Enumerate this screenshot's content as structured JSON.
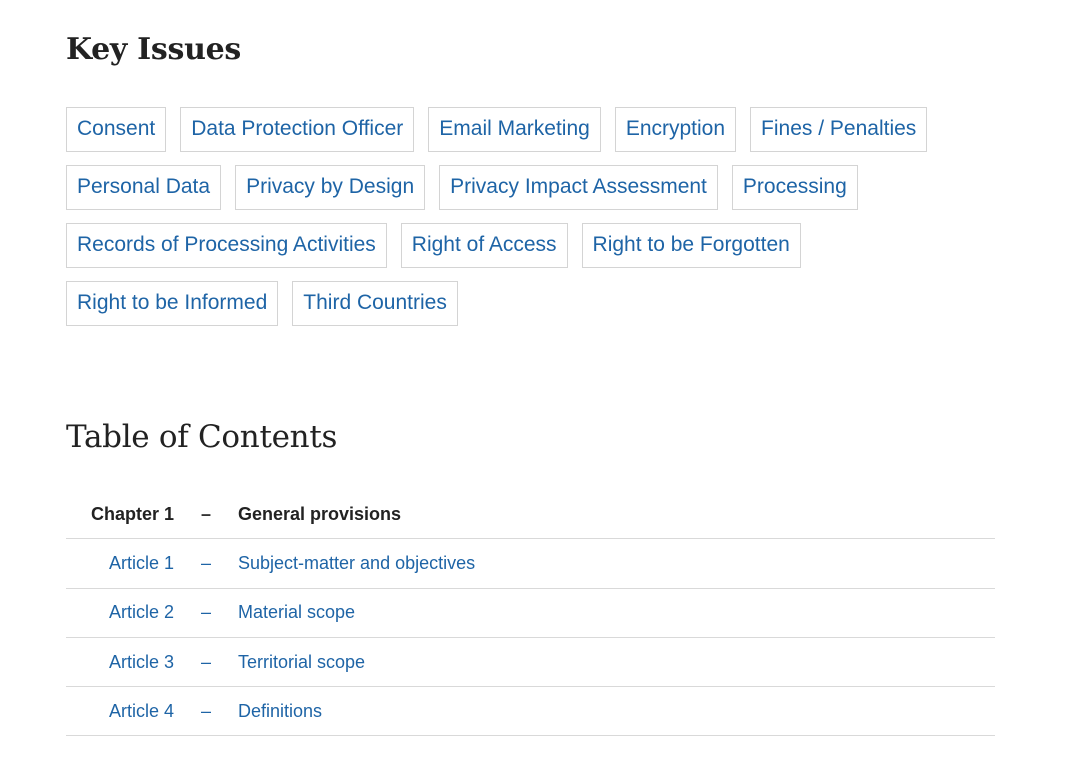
{
  "key_issues": {
    "heading": "Key Issues",
    "tags": [
      "Consent",
      "Data Protection Officer",
      "Email Marketing",
      "Encryption",
      "Fines / Penalties",
      "Personal Data",
      "Privacy by Design",
      "Privacy Impact Assessment",
      "Processing",
      "Records of Processing Activities",
      "Right of Access",
      "Right to be Forgotten",
      "Right to be Informed",
      "Third Countries"
    ]
  },
  "toc": {
    "heading": "Table of Contents",
    "separator": "–",
    "rows": [
      {
        "num": "Chapter 1",
        "title": "General provisions",
        "kind": "chapter"
      },
      {
        "num": "Article 1",
        "title": "Subject-matter and objectives",
        "kind": "article"
      },
      {
        "num": "Article 2",
        "title": "Material scope",
        "kind": "article"
      },
      {
        "num": "Article 3",
        "title": "Territorial scope",
        "kind": "article"
      },
      {
        "num": "Article 4",
        "title": "Definitions",
        "kind": "article"
      }
    ]
  },
  "colors": {
    "link": "#1e64a6",
    "heading": "#222222",
    "border": "#d4d4d4"
  }
}
